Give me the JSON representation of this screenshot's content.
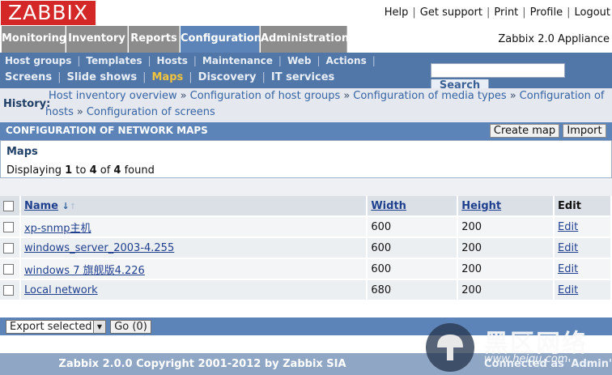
{
  "logo": "ZABBIX",
  "user_menu": [
    "Help",
    "Get support",
    "Print",
    "Profile",
    "Logout"
  ],
  "main_nav": {
    "tabs": [
      "Monitoring",
      "Inventory",
      "Reports",
      "Configuration",
      "Administration"
    ],
    "active": "Configuration",
    "appliance": "Zabbix 2.0 Appliance"
  },
  "sub_nav": {
    "row1": [
      "Host groups",
      "Templates",
      "Hosts",
      "Maintenance",
      "Web",
      "Actions"
    ],
    "row2": [
      "Screens",
      "Slide shows",
      "Maps",
      "Discovery",
      "IT services"
    ],
    "active": "Maps",
    "search_button": "Search",
    "search_value": ""
  },
  "history": {
    "label": "History:",
    "line1": [
      "Host inventory overview",
      "Configuration of host groups",
      "Configuration of media types",
      "Configuration of"
    ],
    "line2": [
      "hosts",
      "Configuration of screens"
    ],
    "sep": "»"
  },
  "header": {
    "title": "CONFIGURATION OF NETWORK MAPS",
    "create_map": "Create map",
    "import": "Import"
  },
  "maps": {
    "title": "Maps",
    "displaying": "Displaying",
    "from": "1",
    "to_word": "to",
    "to": "4",
    "of_word": "of",
    "total": "4",
    "found": "found"
  },
  "table": {
    "columns": [
      "Name",
      "Width",
      "Height",
      "Edit"
    ],
    "sort_arrow": "↓",
    "sort_arrow_faint": "↑",
    "rows": [
      {
        "name": "xp-snmp主机",
        "width": "600",
        "height": "200",
        "edit": "Edit"
      },
      {
        "name": "windows_server_2003-4.255",
        "width": "600",
        "height": "200",
        "edit": "Edit"
      },
      {
        "name": "windows 7 旗舰版4.226",
        "width": "600",
        "height": "200",
        "edit": "Edit"
      },
      {
        "name": "Local network",
        "width": "680",
        "height": "200",
        "edit": "Edit"
      }
    ]
  },
  "footer": {
    "export_selected": "Export selected",
    "go": "Go (0)",
    "copyright": "Zabbix 2.0.0 Copyright 2001-2012 by Zabbix SIA",
    "connected": "Connected as 'Admin'"
  },
  "watermark": {
    "text1": "黑区网络",
    "text2": "www.heiqu.com"
  }
}
